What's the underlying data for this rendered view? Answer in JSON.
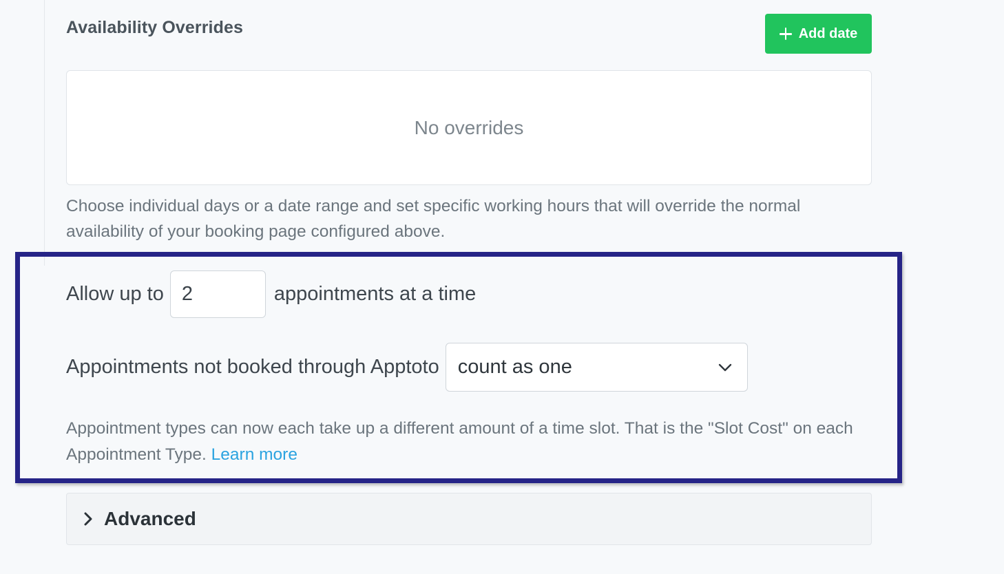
{
  "overrides": {
    "title": "Availability Overrides",
    "add_button_label": "Add date",
    "empty_text": "No overrides",
    "help_text": "Choose individual days or a date range and set specific working hours that will override the normal availability of your booking page configured above."
  },
  "capacity": {
    "prefix_label": "Allow up to",
    "value": "2",
    "suffix_label": "appointments at a time",
    "external_label": "Appointments not booked through Apptoto",
    "external_selected": "count as one",
    "note_text": "Appointment types can now each take up a different amount of a time slot. That is the \"Slot Cost\" on each Appointment Type.",
    "learn_more_label": "Learn more"
  },
  "advanced": {
    "label": "Advanced"
  },
  "colors": {
    "accent_green": "#21c45d",
    "highlight_frame": "#262487",
    "link": "#2ba3e0"
  },
  "icons": {
    "add": "plus-icon",
    "select": "chevron-down-icon",
    "advanced": "chevron-right-icon"
  }
}
